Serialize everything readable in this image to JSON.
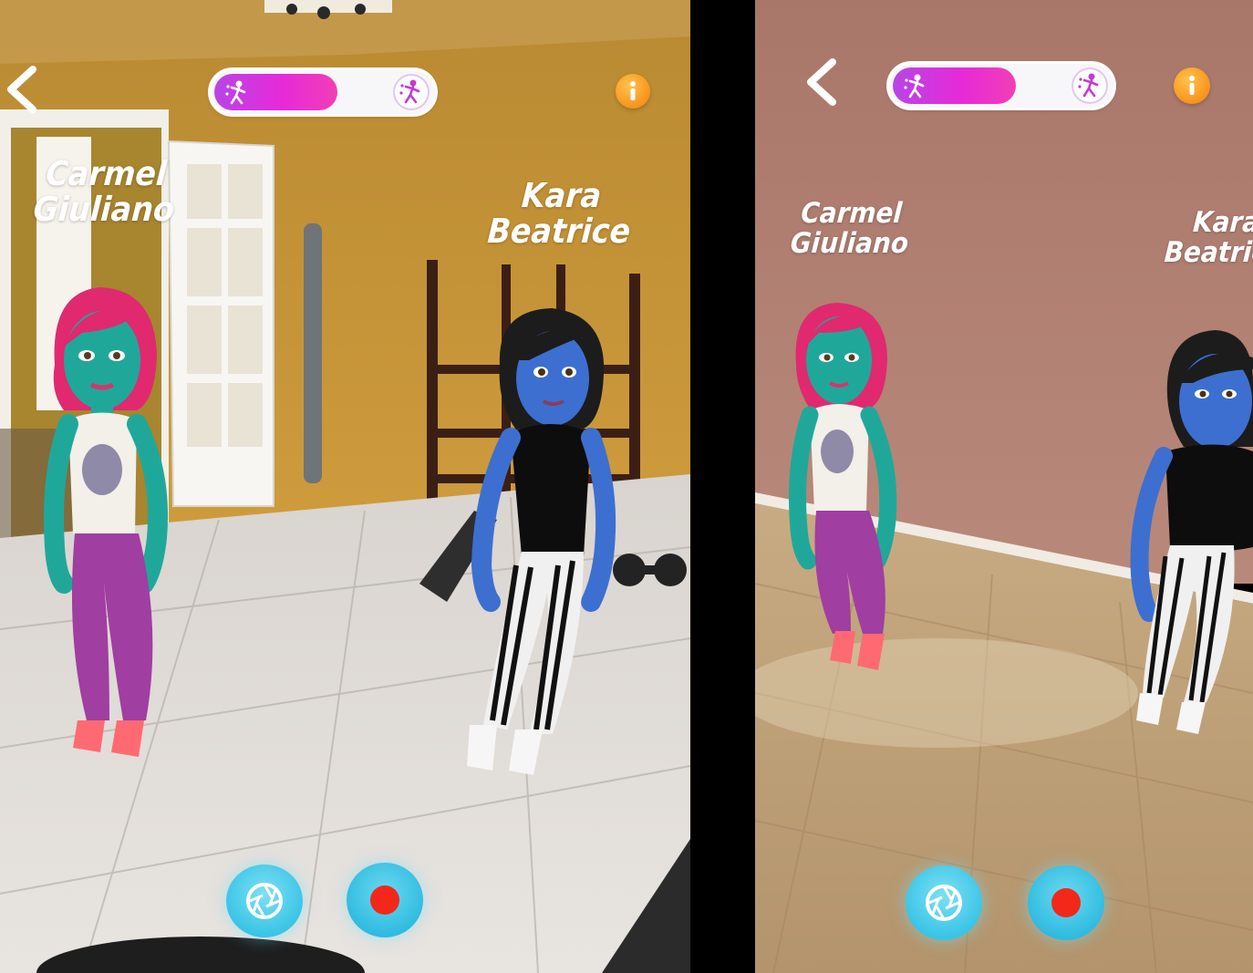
{
  "screens": [
    {
      "avatar_left_name": [
        "Carmel",
        "Giuliano"
      ],
      "avatar_right_name": [
        "Kara",
        "Beatrice"
      ],
      "dance_progress": 0.58
    },
    {
      "avatar_left_name": [
        "Carmel",
        "Giuliano"
      ],
      "avatar_right_name": [
        "Kara",
        "Beatrice"
      ],
      "dance_progress": 0.58
    }
  ],
  "icons": {
    "back": "chevron-left-icon",
    "dancer": "dancer-icon",
    "info": "info-icon",
    "shutter": "camera-shutter-icon",
    "record": "record-icon"
  },
  "colors": {
    "progress_fill": "#e62ad8",
    "camera_button": "#39c4e6",
    "record_dot": "#f4271b",
    "info_button": "#f7941d"
  }
}
